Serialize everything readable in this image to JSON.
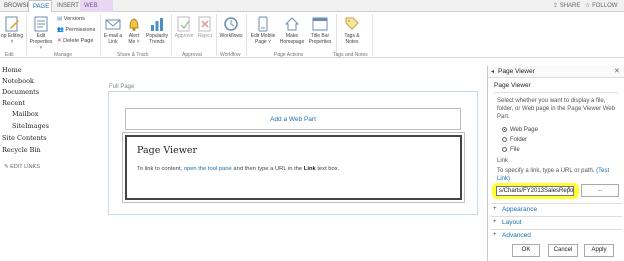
{
  "tabs": [
    "BROWSE",
    "PAGE",
    "INSERT",
    "WEB PART"
  ],
  "top_actions": {
    "share": "SHARE",
    "follow": "FOLLOW"
  },
  "ribbon": {
    "edit_btn": [
      "op Editing",
      "˅"
    ],
    "edit_label": "Edit",
    "edit_properties": [
      "Edit",
      "Properties ˅"
    ],
    "versions": "Versions",
    "permissions": "Permissions",
    "delete_page": "Delete Page",
    "manage_label": "Manage",
    "email_link": [
      "E-mail a",
      "Link"
    ],
    "alert_me": [
      "Alert",
      "Me ˅"
    ],
    "popularity": [
      "Popularity",
      "Trends"
    ],
    "share_track_label": "Share & Track",
    "approve": "Approve",
    "reject": "Reject",
    "approval_label": "Approval",
    "workflows": "Workflows",
    "workflow_label": "Workflow",
    "edit_mobile": [
      "Edit Mobile",
      "Page ˅"
    ],
    "make_homepage": [
      "Make",
      "Homepage"
    ],
    "title_bar_props": [
      "Title Bar",
      "Properties"
    ],
    "page_actions_label": "Page Actions",
    "tags_notes": [
      "Tags &",
      "Notes"
    ],
    "tags_notes_label": "Tags and Notes"
  },
  "nav": {
    "items": [
      "Home",
      "Notebook",
      "Documents",
      "Recent",
      "Mailbox",
      "SiteImages",
      "Site Contents",
      "Recycle Bin"
    ],
    "edit_links": "EDIT LINKS"
  },
  "main": {
    "zone_label": "Full Page",
    "add_web_part": "Add a Web Part",
    "webpart_title": "Page Viewer",
    "webpart_text_1": "To link to content,",
    "webpart_text_link": "open the tool pane",
    "webpart_text_2": "and then type a URL in the",
    "webpart_text_bold": "Link",
    "webpart_text_3": "text box."
  },
  "toolpane": {
    "title": "Page Viewer",
    "collapse_glyph": "◂",
    "close_glyph": "✕",
    "section_title": "Page Viewer",
    "description": "Select whether you want to display a file, folder, or Web page in the Page Viewer Web Part.",
    "options": [
      {
        "label": "Web Page",
        "selected": true
      },
      {
        "label": "Folder",
        "selected": false
      },
      {
        "label": "File",
        "selected": false
      }
    ],
    "link_label": "Link",
    "link_help": "To specify a link, type a URL or path.",
    "link_test": "(Test Link)",
    "url_value": "s/Charts/FY2013SalesRepo",
    "url_clear": "×",
    "browse_btn": "...",
    "sections": [
      "Appearance",
      "Layout",
      "Advanced"
    ],
    "ok": "OK",
    "cancel": "Cancel",
    "apply": "Apply"
  },
  "colors": {
    "accent": "#1a6fb0",
    "highlight": "#ffff33",
    "webpart_tab": "#e8d7f1"
  }
}
